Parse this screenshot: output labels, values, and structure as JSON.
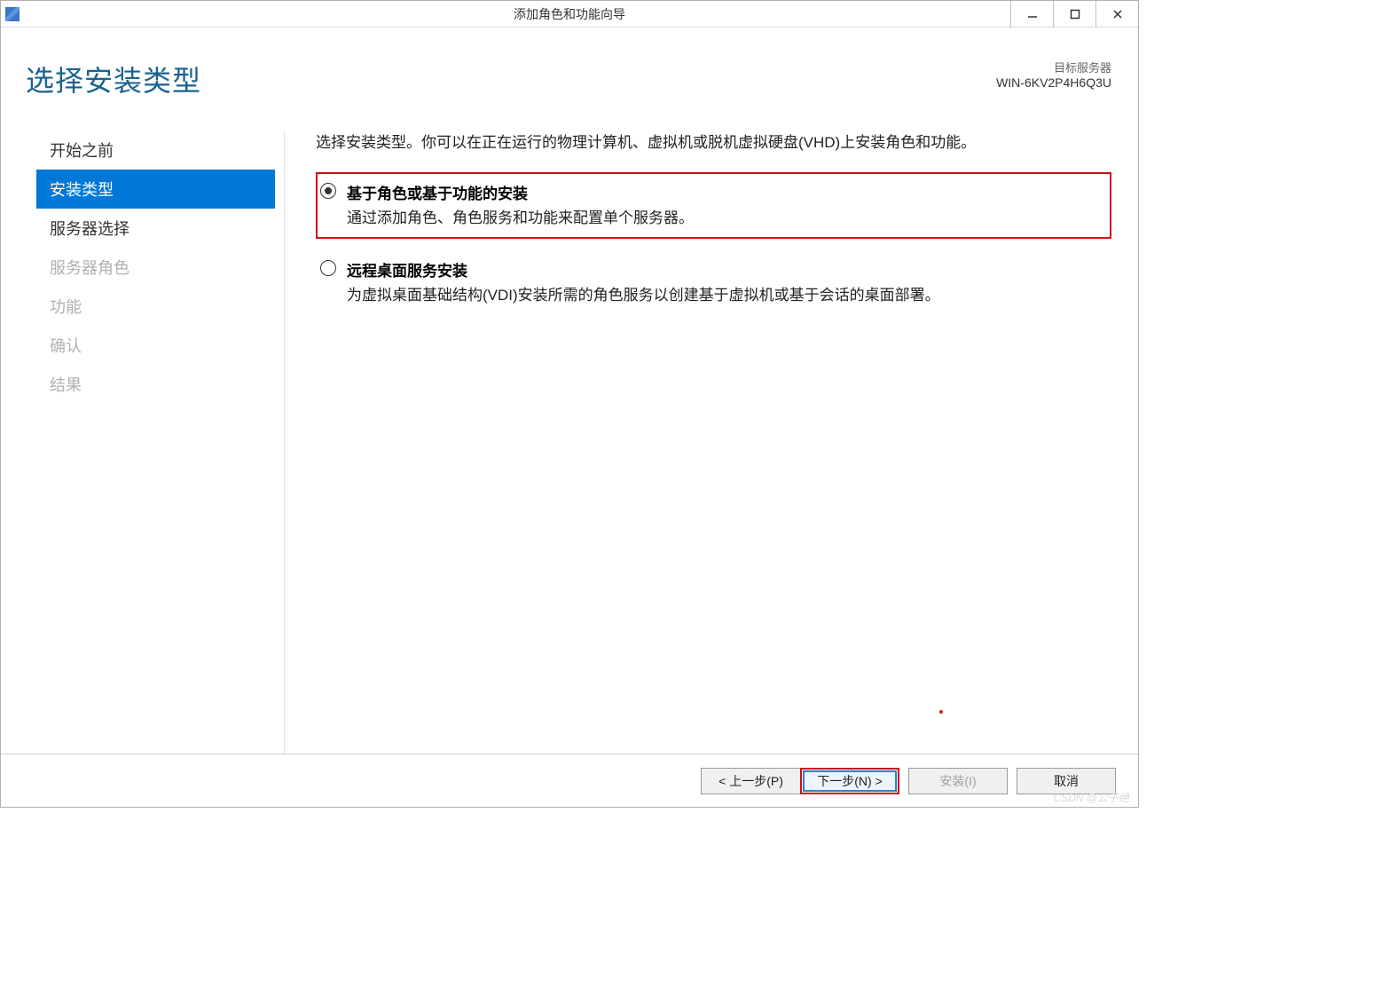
{
  "titlebar": {
    "title": "添加角色和功能向导"
  },
  "header": {
    "page_title": "选择安装类型",
    "target_label": "目标服务器",
    "target_name": "WIN-6KV2P4H6Q3U"
  },
  "sidebar": {
    "items": [
      {
        "label": "开始之前",
        "state": "normal"
      },
      {
        "label": "安装类型",
        "state": "active"
      },
      {
        "label": "服务器选择",
        "state": "normal"
      },
      {
        "label": "服务器角色",
        "state": "disabled"
      },
      {
        "label": "功能",
        "state": "disabled"
      },
      {
        "label": "确认",
        "state": "disabled"
      },
      {
        "label": "结果",
        "state": "disabled"
      }
    ]
  },
  "main": {
    "instruction": "选择安装类型。你可以在正在运行的物理计算机、虚拟机或脱机虚拟硬盘(VHD)上安装角色和功能。",
    "options": [
      {
        "title": "基于角色或基于功能的安装",
        "desc": "通过添加角色、角色服务和功能来配置单个服务器。",
        "selected": true,
        "highlighted": true
      },
      {
        "title": "远程桌面服务安装",
        "desc": "为虚拟桌面基础结构(VDI)安装所需的角色服务以创建基于虚拟机或基于会话的桌面部署。",
        "selected": false,
        "highlighted": false
      }
    ]
  },
  "footer": {
    "previous": "< 上一步(P)",
    "next": "下一步(N) >",
    "install": "安装(I)",
    "cancel": "取消"
  },
  "watermark": "CSDN @公子绝"
}
